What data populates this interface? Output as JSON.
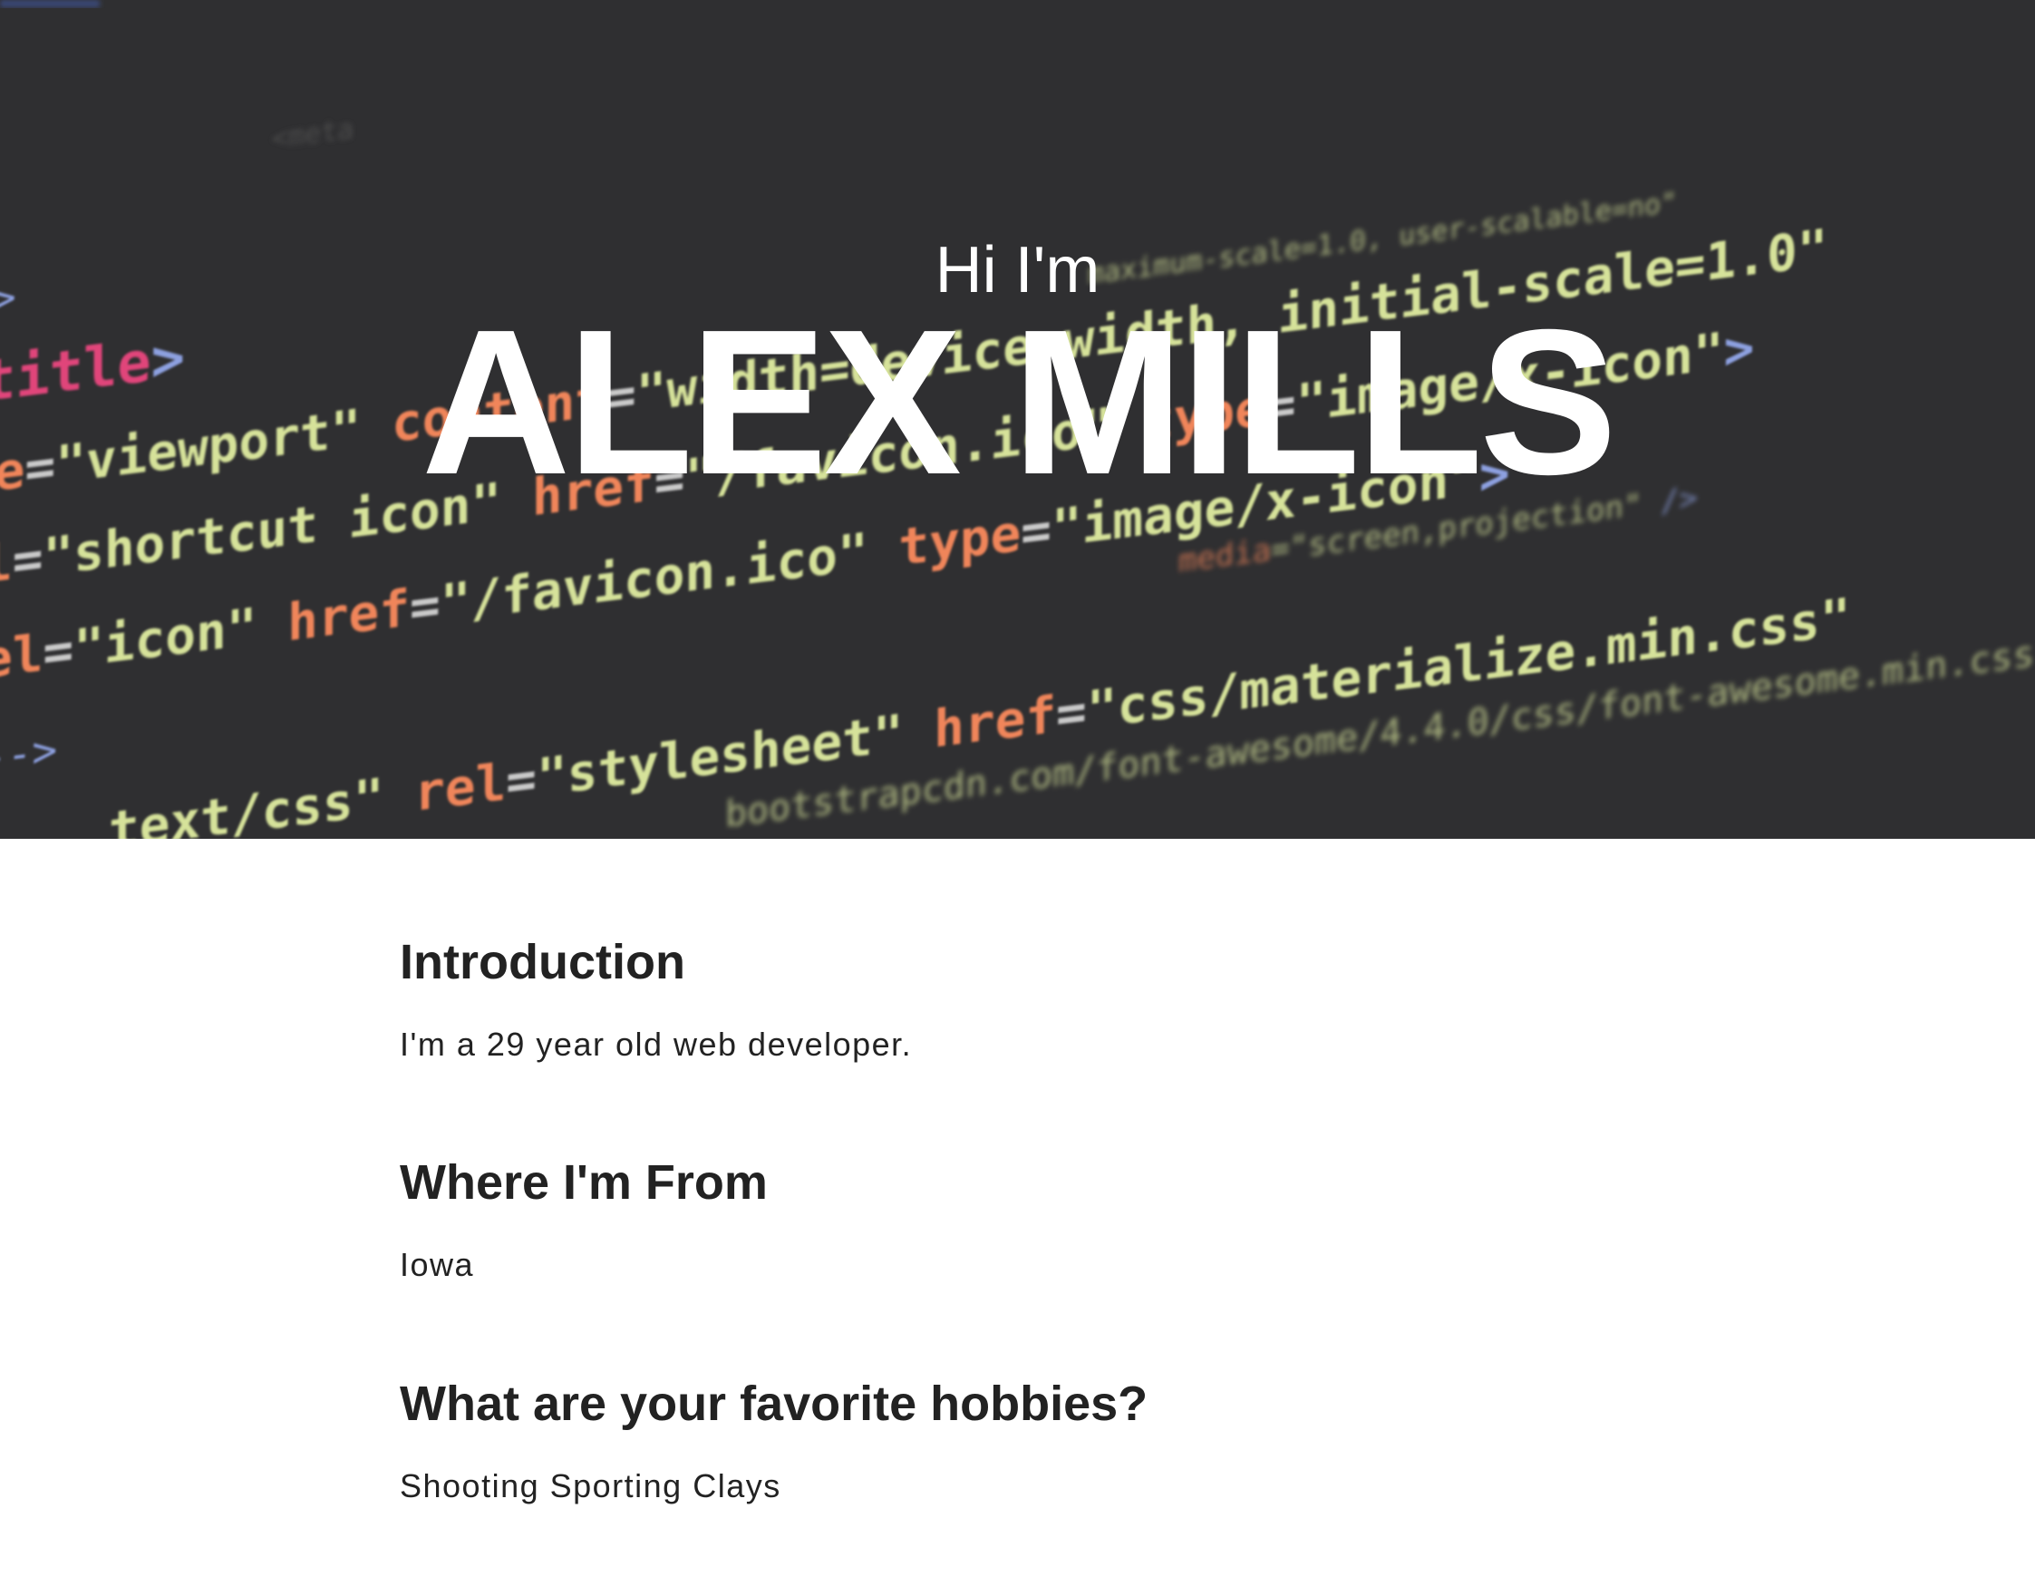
{
  "hero": {
    "greeting": "Hi I'm",
    "name": "ALEX MILLS"
  },
  "sections": [
    {
      "heading": "Introduction",
      "text": "I'm a 29 year old web developer."
    },
    {
      "heading": "Where I'm From",
      "text": "Iowa"
    },
    {
      "heading": "What are your favorite hobbies?",
      "text": "Shooting Sporting Clays"
    }
  ]
}
